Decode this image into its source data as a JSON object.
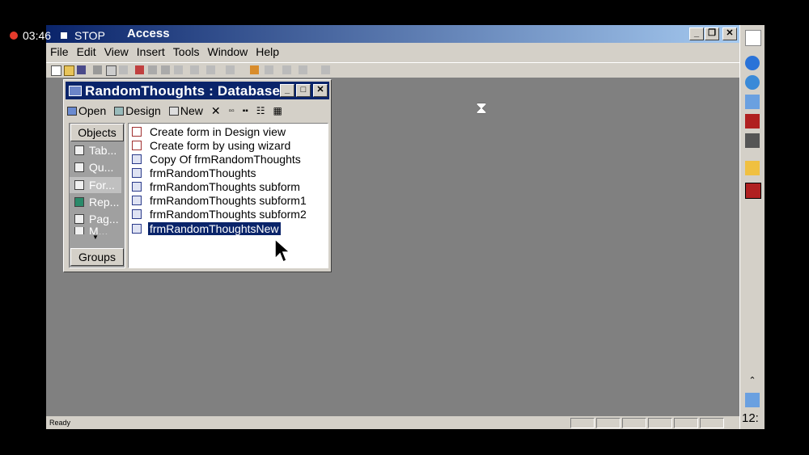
{
  "overlay": {
    "time": "03:46",
    "stop_label": "STOP"
  },
  "app": {
    "title": "Access",
    "menus": [
      "File",
      "Edit",
      "View",
      "Insert",
      "Tools",
      "Window",
      "Help"
    ],
    "status": "Ready"
  },
  "db_window": {
    "title": "RandomThoughts : Database",
    "toolbar": {
      "open": "Open",
      "design": "Design",
      "new": "New"
    },
    "objects_header": "Objects",
    "groups_header": "Groups",
    "objects": [
      "Tab...",
      "Qu...",
      "For...",
      "Rep...",
      "Pag...",
      "M..."
    ],
    "items": [
      "Create form in Design view",
      "Create form by using wizard",
      "Copy Of frmRandomThoughts",
      "frmRandomThoughts",
      "frmRandomThoughts subform",
      "frmRandomThoughts subform1",
      "frmRandomThoughts subform2",
      "frmRandomThoughtsNew"
    ]
  },
  "taskbar": {
    "clock": "12:"
  },
  "colors": {
    "title_blue": "#0a246a",
    "selection": "#0a246a",
    "workspace": "#808080"
  }
}
